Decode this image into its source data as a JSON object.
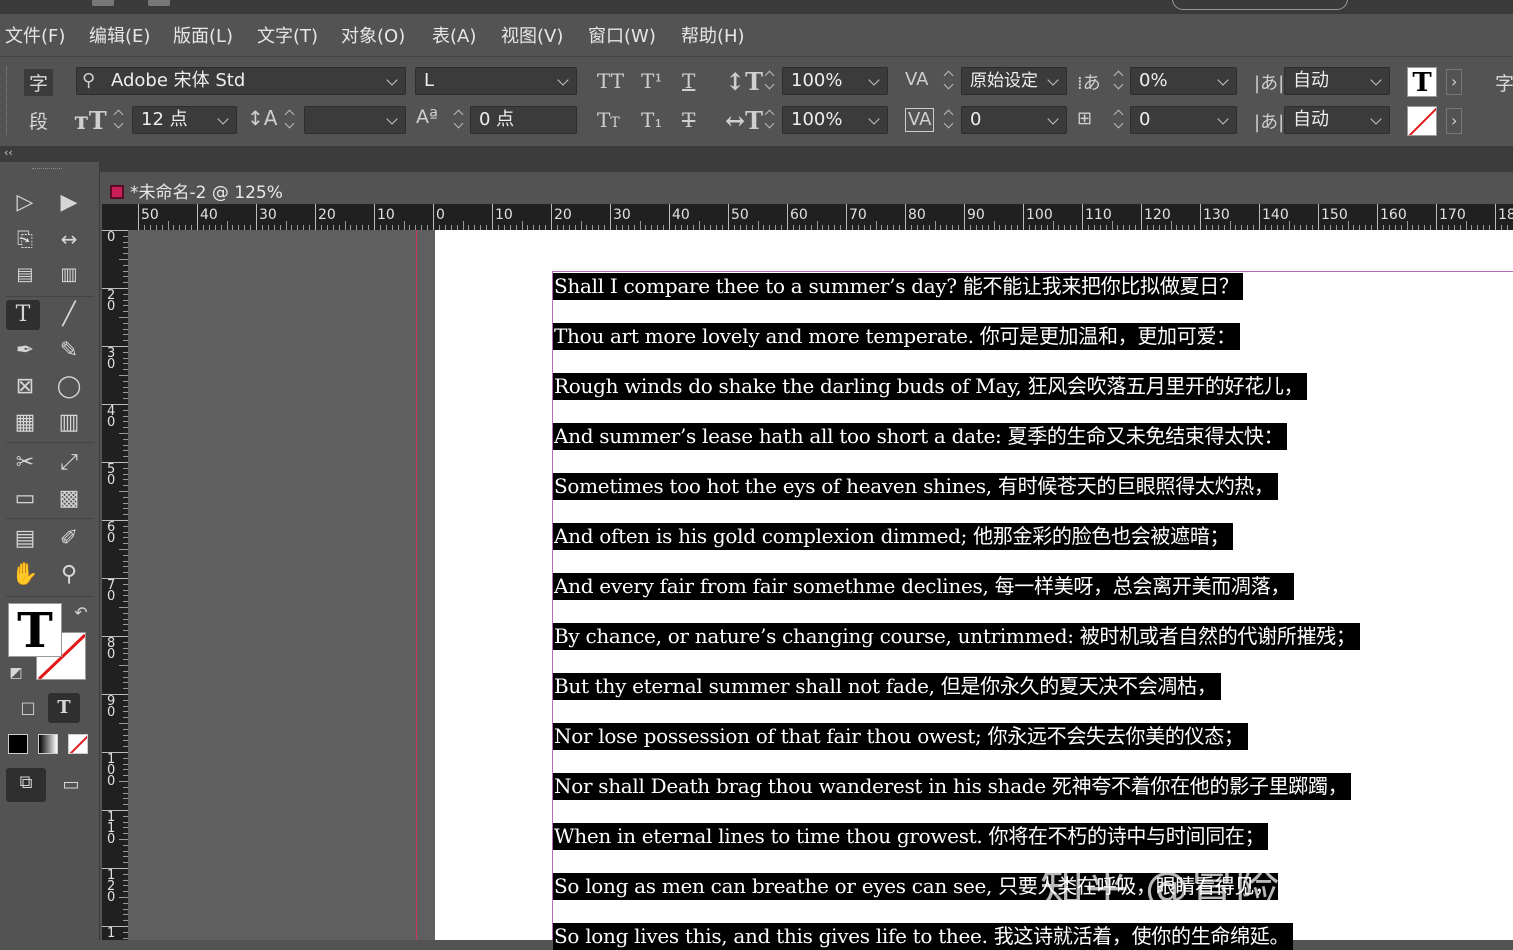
{
  "menu": [
    "文件(F)",
    "编辑(E)",
    "版面(L)",
    "文字(T)",
    "对象(O)",
    "表(A)",
    "视图(V)",
    "窗口(W)",
    "帮助(H)"
  ],
  "control": {
    "char_tab": "字",
    "para_tab": "段",
    "font_family": "Adobe 宋体 Std",
    "font_style": "L",
    "font_size": "12 点",
    "leading": "",
    "kerning_label": "原始设定",
    "baseline_shift": "0 点",
    "vertical_scale": "100%",
    "horizontal_scale": "100%",
    "tracking": "0",
    "tsume": "0%",
    "grid_alignment": "0",
    "mojikumi_top": "自动",
    "mojikumi_bottom": "自动",
    "right_edge_label": "字"
  },
  "document": {
    "tab_title": "*未命名-2 @ 125%"
  },
  "ruler": {
    "h_ticks": [
      "50",
      "40",
      "30",
      "20",
      "10",
      "0",
      "10",
      "20",
      "30",
      "40",
      "50",
      "60",
      "70",
      "80",
      "90",
      "100",
      "110",
      "120",
      "130",
      "140",
      "150",
      "160",
      "170",
      "18"
    ],
    "v_ticks": [
      "0",
      "20",
      "30",
      "40",
      "50",
      "60",
      "70",
      "80",
      "90",
      "100",
      "110",
      "120",
      "1"
    ]
  },
  "poem": [
    "Shall I compare thee to a summer’s day? 能不能让我来把你比拟做夏日？",
    "Thou art more lovely and more temperate. 你可是更加温和，更加可爱：",
    "Rough winds do shake the darling buds of May, 狂风会吹落五月里开的好花儿，",
    "And summer’s lease hath all too short a date: 夏季的生命又未免结束得太快：",
    "Sometimes too hot the eys of heaven shines, 有时候苍天的巨眼照得太灼热，",
    "And often is his gold complexion dimmed; 他那金彩的脸色也会被遮暗；",
    "And every fair from fair somethme declines, 每一样美呀，总会离开美而凋落，",
    "By chance, or nature’s changing course, untrimmed: 被时机或者自然的代谢所摧残；",
    "But thy eternal summer shall not fade, 但是你永久的夏天决不会凋枯，",
    "Nor lose possession of that fair thou owest; 你永远不会失去你美的仪态；",
    "Nor shall Death brag thou wanderest in his shade 死神夸不着你在他的影子里踯躅，",
    "When in eternal lines to time thou growest. 你将在不朽的诗中与时间同在；",
    "So long as men can breathe or eyes can see, 只要人类在呼吸，眼睛看得见，",
    "So long lives this, and this gives life to thee. 我这诗就活着，使你的生命绵延。"
  ],
  "watermark": "知乎 @冒险的Cutfish",
  "colors": {
    "ui_bg": "#535353",
    "ruler_bg": "#202020",
    "pasteboard": "#5f5f5f",
    "selection": "#000000",
    "bleed_guide": "#d0335b",
    "margin_guide": "#b86ab8"
  }
}
